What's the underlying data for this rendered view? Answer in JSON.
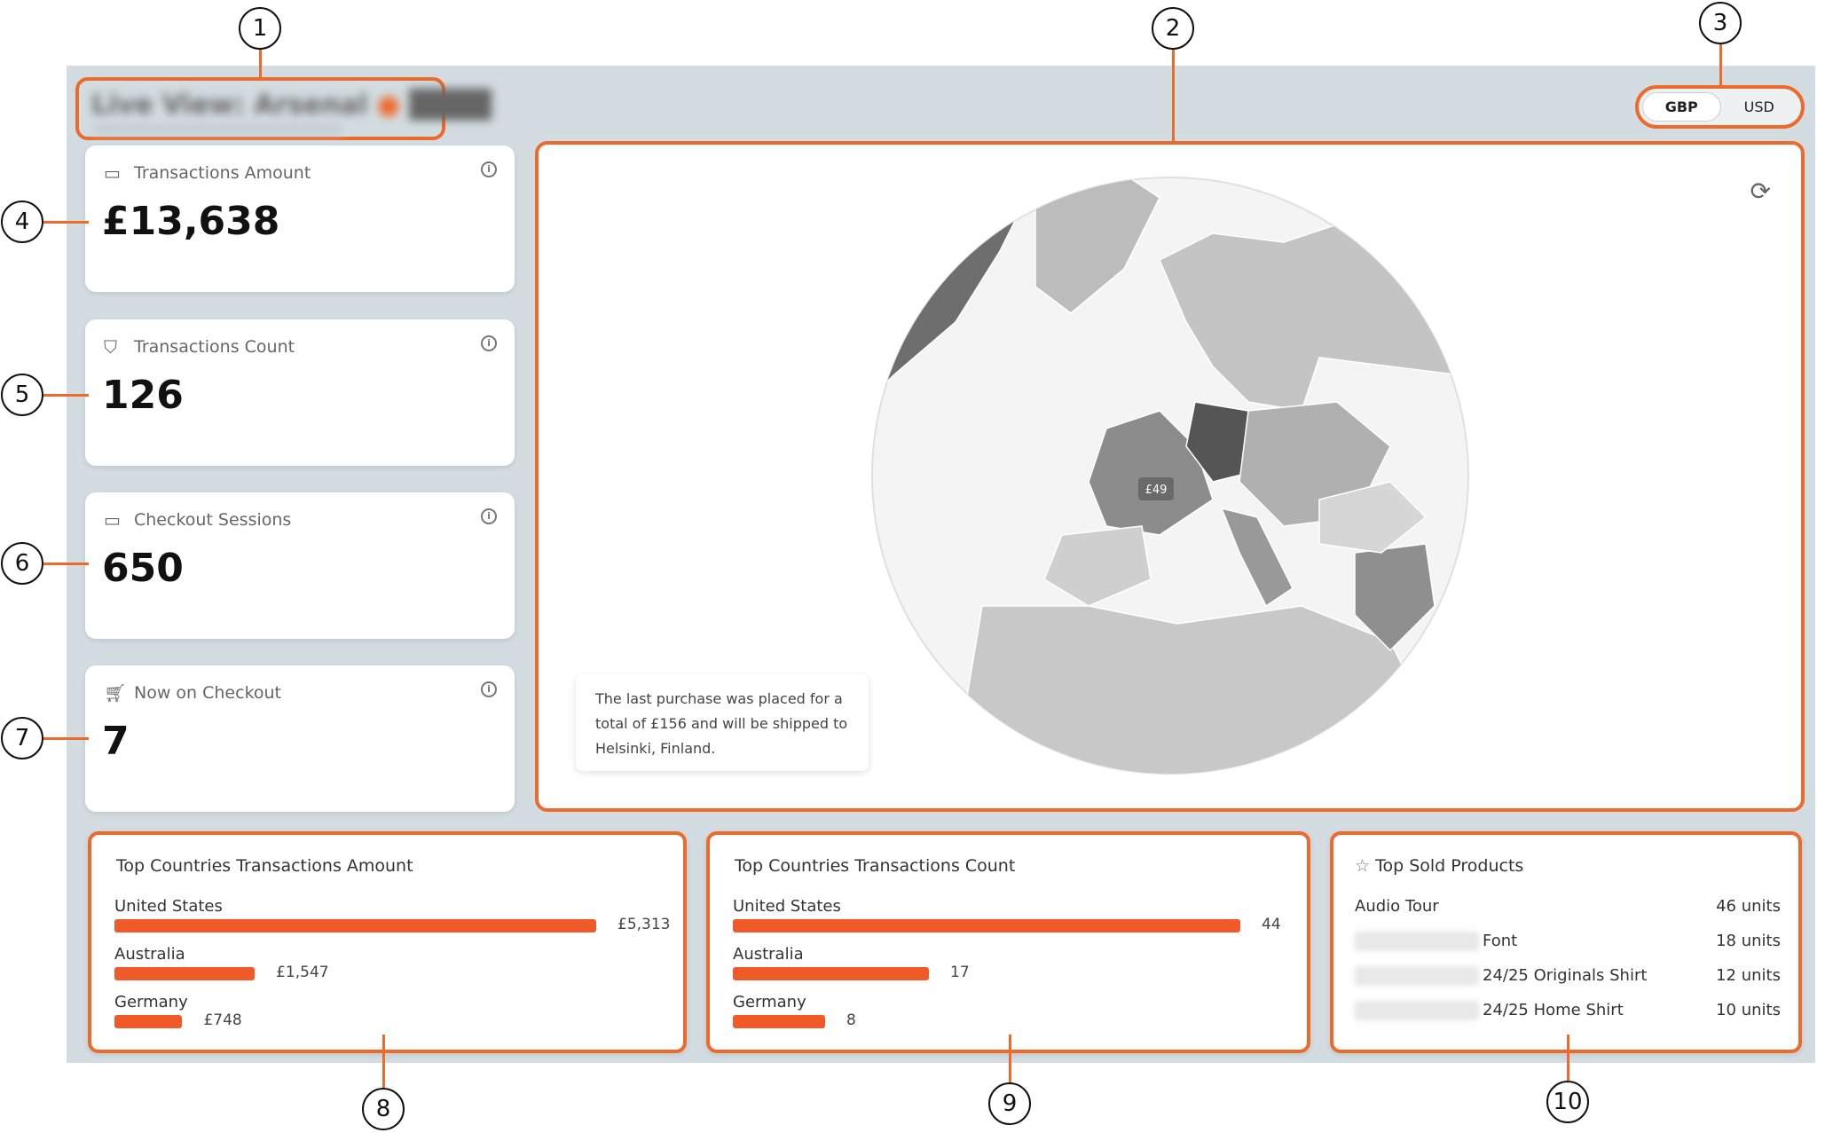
{
  "header": {
    "title_blurred": "Live View: Arsenal",
    "subtitle_blurred": "redacted"
  },
  "currency": {
    "options": [
      "GBP",
      "USD"
    ],
    "selected": "GBP"
  },
  "kpis": [
    {
      "label": "Transactions Amount",
      "value": "£13,638",
      "icon": "credit-card-icon"
    },
    {
      "label": "Transactions Count",
      "value": "126",
      "icon": "shopping-bag-icon"
    },
    {
      "label": "Checkout Sessions",
      "value": "650",
      "icon": "calendar-icon"
    },
    {
      "label": "Now on Checkout",
      "value": "7",
      "icon": "cart-icon"
    }
  ],
  "map": {
    "pin_label": "£49",
    "tooltip": "The last purchase was placed for a total of £156 and will be shipped to Helsinki, Finland.",
    "highlight_color": "#5a5a5a",
    "accent": "#f05a28"
  },
  "top_amount": {
    "title": "Top Countries Transactions Amount",
    "rows": [
      {
        "country": "United States",
        "value": 5313,
        "label": "£5,313"
      },
      {
        "country": "Australia",
        "value": 1547,
        "label": "£1,547"
      },
      {
        "country": "Germany",
        "value": 748,
        "label": "£748"
      }
    ]
  },
  "top_count": {
    "title": "Top Countries Transactions Count",
    "rows": [
      {
        "country": "United States",
        "value": 44,
        "label": "44"
      },
      {
        "country": "Australia",
        "value": 17,
        "label": "17"
      },
      {
        "country": "Germany",
        "value": 8,
        "label": "8"
      }
    ]
  },
  "top_products": {
    "title": "Top Sold Products",
    "rows": [
      {
        "name": "Audio Tour",
        "blurred_prefix": false,
        "units": "46 units"
      },
      {
        "name": "Font",
        "blurred_prefix": true,
        "units": "18 units"
      },
      {
        "name": "24/25 Originals Shirt",
        "blurred_prefix": true,
        "units": "12 units"
      },
      {
        "name": "24/25 Home Shirt",
        "blurred_prefix": true,
        "units": "10 units"
      }
    ]
  },
  "callouts": [
    "1",
    "2",
    "3",
    "4",
    "5",
    "6",
    "7",
    "8",
    "9",
    "10"
  ]
}
